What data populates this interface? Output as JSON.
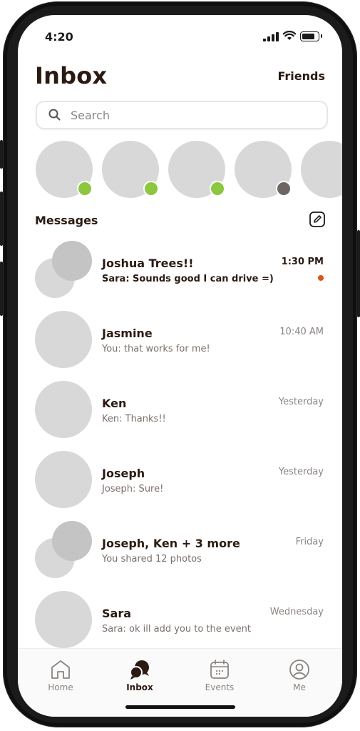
{
  "status": {
    "time": "4:20"
  },
  "header": {
    "title": "Inbox",
    "friends_label": "Friends"
  },
  "search": {
    "placeholder": "Search"
  },
  "stories": [
    {
      "status_color": "#8dc63f"
    },
    {
      "status_color": "#8dc63f"
    },
    {
      "status_color": "#8dc63f"
    },
    {
      "status_color": "#6e6662"
    },
    {
      "status_color": null
    }
  ],
  "messages": {
    "label": "Messages",
    "items": [
      {
        "name": "Joshua Trees!!",
        "preview": "Sara: Sounds good I can drive =)",
        "time": "1:30 PM",
        "unread": true,
        "group": true
      },
      {
        "name": "Jasmine",
        "preview": "You: that works for me!",
        "time": "10:40 AM",
        "unread": false,
        "group": false
      },
      {
        "name": "Ken",
        "preview": "Ken: Thanks!!",
        "time": "Yesterday",
        "unread": false,
        "group": false
      },
      {
        "name": "Joseph",
        "preview": "Joseph: Sure!",
        "time": "Yesterday",
        "unread": false,
        "group": false
      },
      {
        "name": "Joseph, Ken + 3 more",
        "preview": "You shared 12 photos",
        "time": "Friday",
        "unread": false,
        "group": true
      },
      {
        "name": "Sara",
        "preview": "Sara: ok ill add you to the event",
        "time": "Wednesday",
        "unread": false,
        "group": false
      }
    ]
  },
  "tabbar": {
    "tabs": [
      {
        "label": "Home",
        "icon": "home-icon"
      },
      {
        "label": "Inbox",
        "icon": "chat-bubbles-icon",
        "active": true
      },
      {
        "label": "Events",
        "icon": "calendar-icon"
      },
      {
        "label": "Me",
        "icon": "profile-icon"
      }
    ]
  },
  "colors": {
    "accent_unread": "#e0521a",
    "online": "#8dc63f",
    "text_dark": "#2a1a12"
  }
}
